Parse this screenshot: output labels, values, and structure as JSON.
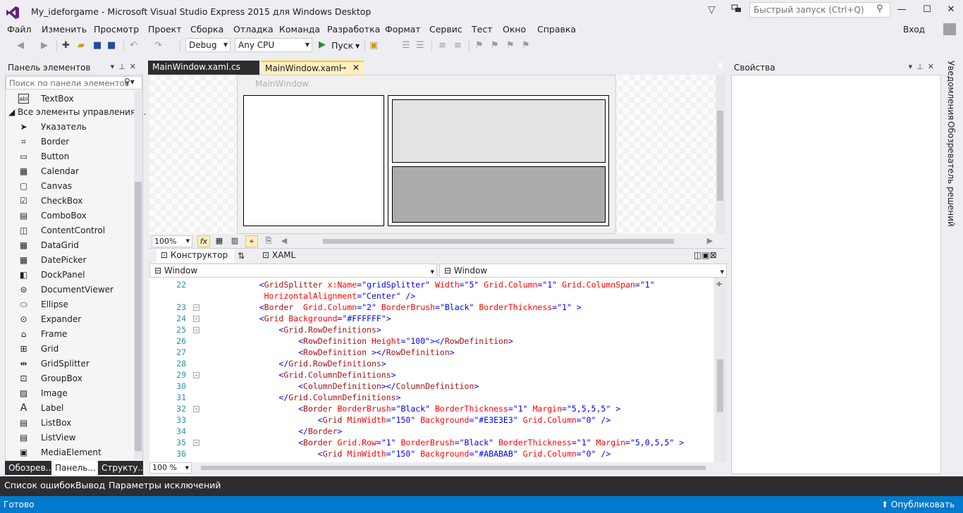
{
  "window": {
    "title": "My_ideforgame - Microsoft Visual Studio Express 2015 для Windows Desktop",
    "quick_launch_placeholder": "Быстрый запуск (Ctrl+Q)",
    "min": "—",
    "max": "☐",
    "close": "✕"
  },
  "menu": {
    "items": [
      "Файл",
      "Изменить",
      "Просмотр",
      "Проект",
      "Сборка",
      "Отладка",
      "Команда",
      "Разработка",
      "Формат",
      "Сервис",
      "Тест",
      "Окно",
      "Справка"
    ],
    "signin": "Вход"
  },
  "toolbar": {
    "config": "Debug",
    "platform": "Any CPU",
    "run": "Пуск"
  },
  "toolbox": {
    "title": "Панель элементов",
    "search_placeholder": "Поиск по панели элементов",
    "group": "Все элементы управления ...",
    "items": [
      "TextBox",
      "Указатель",
      "Border",
      "Button",
      "Calendar",
      "Canvas",
      "CheckBox",
      "ComboBox",
      "ContentControl",
      "DataGrid",
      "DatePicker",
      "DockPanel",
      "DocumentViewer",
      "Ellipse",
      "Expander",
      "Frame",
      "Grid",
      "GridSplitter",
      "GroupBox",
      "Image",
      "Label",
      "ListBox",
      "ListView",
      "MediaElement"
    ],
    "bottom_tabs": [
      "Обозрев...",
      "Панель...",
      "Структу..."
    ]
  },
  "editor": {
    "tabs": [
      "MainWindow.xaml.cs",
      "MainWindow.xaml"
    ],
    "designer_window_title": "MainWindow",
    "zoom": "100%",
    "view_tabs": [
      "Конструктор",
      "XAML"
    ],
    "nav_left": "Window",
    "nav_right": "Window",
    "code_zoom": "100 %",
    "lines": [
      {
        "n": "22",
        "fold": "",
        "indent": 4,
        "parts": [
          [
            "b",
            "<"
          ],
          [
            "m",
            "GridSplitter"
          ],
          [
            "r",
            " x:Name"
          ],
          [
            "b",
            "=\""
          ],
          [
            "b",
            "gridSplitter"
          ],
          [
            "b",
            "\""
          ],
          [
            "r",
            " Width"
          ],
          [
            "b",
            "=\"5\""
          ],
          [
            "r",
            " Grid.Column"
          ],
          [
            "b",
            "=\"1\""
          ],
          [
            "r",
            " Grid.ColumnSpan"
          ],
          [
            "b",
            "=\"1\""
          ]
        ]
      },
      {
        "n": "",
        "fold": "",
        "indent": 5,
        "parts": [
          [
            "r",
            "HorizontalAlignment"
          ],
          [
            "b",
            "=\"Center\""
          ],
          [
            "b",
            " />"
          ]
        ]
      },
      {
        "n": "23",
        "fold": "-",
        "indent": 4,
        "parts": [
          [
            "b",
            "<"
          ],
          [
            "m",
            "Border"
          ],
          [
            "r",
            "  Grid.Column"
          ],
          [
            "b",
            "=\"2\""
          ],
          [
            "r",
            " BorderBrush"
          ],
          [
            "b",
            "=\"Black\""
          ],
          [
            "r",
            " BorderThickness"
          ],
          [
            "b",
            "=\"1\""
          ],
          [
            "b",
            " >"
          ]
        ]
      },
      {
        "n": "24",
        "fold": "-",
        "indent": 4,
        "parts": [
          [
            "b",
            "<"
          ],
          [
            "m",
            "Grid"
          ],
          [
            "r",
            " Background"
          ],
          [
            "b",
            "=\"#FFFFFF\""
          ],
          [
            "b",
            ">"
          ]
        ]
      },
      {
        "n": "25",
        "fold": "-",
        "indent": 8,
        "parts": [
          [
            "b",
            "<"
          ],
          [
            "m",
            "Grid.RowDefinitions"
          ],
          [
            "b",
            ">"
          ]
        ]
      },
      {
        "n": "26",
        "fold": "",
        "indent": 12,
        "parts": [
          [
            "b",
            "<"
          ],
          [
            "m",
            "RowDefinition"
          ],
          [
            "r",
            " Height"
          ],
          [
            "b",
            "=\"100\""
          ],
          [
            "b",
            "></"
          ],
          [
            "m",
            "RowDefinition"
          ],
          [
            "b",
            ">"
          ]
        ]
      },
      {
        "n": "27",
        "fold": "",
        "indent": 12,
        "parts": [
          [
            "b",
            "<"
          ],
          [
            "m",
            "RowDefinition"
          ],
          [
            "b",
            " ></"
          ],
          [
            "m",
            "RowDefinition"
          ],
          [
            "b",
            ">"
          ]
        ]
      },
      {
        "n": "28",
        "fold": "",
        "indent": 8,
        "parts": [
          [
            "b",
            "</"
          ],
          [
            "m",
            "Grid.RowDefinitions"
          ],
          [
            "b",
            ">"
          ]
        ]
      },
      {
        "n": "29",
        "fold": "-",
        "indent": 8,
        "parts": [
          [
            "b",
            "<"
          ],
          [
            "m",
            "Grid.ColumnDefinitions"
          ],
          [
            "b",
            ">"
          ]
        ]
      },
      {
        "n": "30",
        "fold": "",
        "indent": 12,
        "parts": [
          [
            "b",
            "<"
          ],
          [
            "m",
            "ColumnDefinition"
          ],
          [
            "b",
            "></"
          ],
          [
            "m",
            "ColumnDefinition"
          ],
          [
            "b",
            ">"
          ]
        ]
      },
      {
        "n": "31",
        "fold": "",
        "indent": 8,
        "parts": [
          [
            "b",
            "</"
          ],
          [
            "m",
            "Grid.ColumnDefinitions"
          ],
          [
            "b",
            ">"
          ]
        ]
      },
      {
        "n": "32",
        "fold": "-",
        "indent": 12,
        "parts": [
          [
            "b",
            "<"
          ],
          [
            "m",
            "Border"
          ],
          [
            "r",
            " BorderBrush"
          ],
          [
            "b",
            "=\"Black\""
          ],
          [
            "r",
            " BorderThickness"
          ],
          [
            "b",
            "=\"1\""
          ],
          [
            "r",
            " Margin"
          ],
          [
            "b",
            "=\"5,5,5,5\""
          ],
          [
            "b",
            " >"
          ]
        ]
      },
      {
        "n": "33",
        "fold": "",
        "indent": 16,
        "parts": [
          [
            "b",
            "<"
          ],
          [
            "m",
            "Grid"
          ],
          [
            "r",
            " MinWidth"
          ],
          [
            "b",
            "=\"150\""
          ],
          [
            "r",
            " Background"
          ],
          [
            "b",
            "=\"#E3E3E3\""
          ],
          [
            "r",
            " Grid.Column"
          ],
          [
            "b",
            "=\"0\""
          ],
          [
            "b",
            " />"
          ]
        ]
      },
      {
        "n": "34",
        "fold": "",
        "indent": 12,
        "parts": [
          [
            "b",
            "</"
          ],
          [
            "m",
            "Border"
          ],
          [
            "b",
            ">"
          ]
        ]
      },
      {
        "n": "35",
        "fold": "-",
        "indent": 12,
        "parts": [
          [
            "b",
            "<"
          ],
          [
            "m",
            "Border"
          ],
          [
            "r",
            " Grid.Row"
          ],
          [
            "b",
            "=\"1\""
          ],
          [
            "r",
            " BorderBrush"
          ],
          [
            "b",
            "=\"Black\""
          ],
          [
            "r",
            " BorderThickness"
          ],
          [
            "b",
            "=\"1\""
          ],
          [
            "r",
            " Margin"
          ],
          [
            "b",
            "=\"5,0,5,5\""
          ],
          [
            "b",
            " >"
          ]
        ]
      },
      {
        "n": "36",
        "fold": "",
        "indent": 16,
        "parts": [
          [
            "b",
            "<"
          ],
          [
            "m",
            "Grid"
          ],
          [
            "r",
            " MinWidth"
          ],
          [
            "b",
            "=\"150\""
          ],
          [
            "r",
            " Background"
          ],
          [
            "b",
            "=\"#ABABAB\""
          ],
          [
            "r",
            " Grid.Column"
          ],
          [
            "b",
            "=\"0\""
          ],
          [
            "b",
            " />"
          ]
        ]
      }
    ]
  },
  "properties": {
    "title": "Свойства"
  },
  "side_tabs": [
    "Уведомления",
    "Обозреватель решений"
  ],
  "bottom_panels": [
    "Список ошибок",
    "Вывод",
    "Параметры исключений"
  ],
  "status": {
    "text": "Готово",
    "publish": "Опубликовать"
  },
  "colors": {
    "accent": "#007acc",
    "vs_purple": "#68217a",
    "tab_active": "#ffefbf"
  }
}
